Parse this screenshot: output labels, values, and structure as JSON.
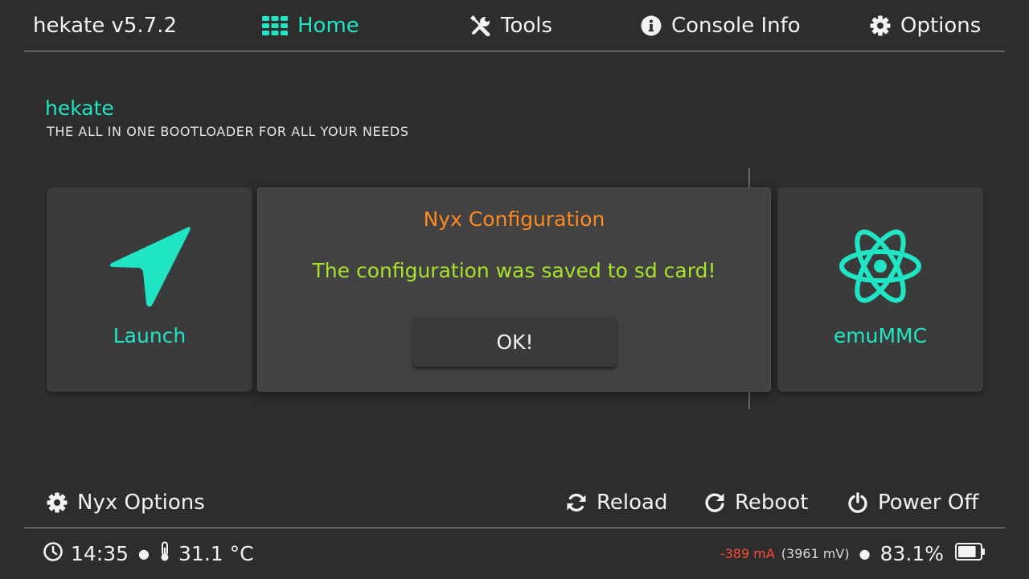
{
  "topbar": {
    "app_title": "hekate v5.7.2",
    "nav": [
      {
        "label": "Home",
        "icon": "grid-icon",
        "active": true
      },
      {
        "label": "Tools",
        "icon": "tools-icon",
        "active": false
      },
      {
        "label": "Console Info",
        "icon": "info-icon",
        "active": false
      },
      {
        "label": "Options",
        "icon": "gear-icon",
        "active": false
      }
    ]
  },
  "header": {
    "title": "hekate",
    "subtitle": "THE ALL IN ONE BOOTLOADER FOR ALL YOUR NEEDS"
  },
  "tiles": [
    {
      "label": "Launch",
      "icon": "navigation-arrow-icon"
    },
    {
      "label": "emuMMC",
      "icon": "atom-icon"
    }
  ],
  "dialog": {
    "title": "Nyx Configuration",
    "message": "The configuration was saved to sd card!",
    "ok_label": "OK!"
  },
  "bottom": {
    "nyx_options": "Nyx Options",
    "reload": "Reload",
    "reboot": "Reboot",
    "power_off": "Power Off"
  },
  "status": {
    "time": "14:35",
    "temperature": "31.1 °C",
    "current": "-389 mA",
    "voltage": "(3961 mV)",
    "battery_percent": "83.1%",
    "battery_level": 0.831
  },
  "colors": {
    "accent": "#1fe5c4",
    "dialog_title": "#ff8a1f",
    "dialog_message": "#a7e32a",
    "current_negative": "#ff4a3a",
    "background": "#2d2d2d"
  }
}
